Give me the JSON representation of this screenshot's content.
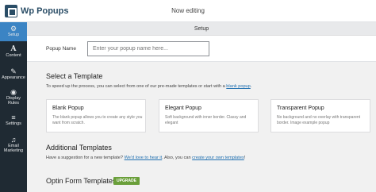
{
  "app": {
    "logo_text": "Wp Popups",
    "status": "Now editing"
  },
  "sidebar": {
    "items": [
      {
        "label": "Setup",
        "icon": "gear-icon"
      },
      {
        "label": "Content",
        "icon": "text-icon"
      },
      {
        "label": "Appearance",
        "icon": "paint-icon"
      },
      {
        "label": "Display Rules",
        "icon": "eye-icon"
      },
      {
        "label": "Settings",
        "icon": "sliders-icon"
      },
      {
        "label": "Email Marketing",
        "icon": "megaphone-icon"
      }
    ]
  },
  "header": {
    "section_title": "Setup"
  },
  "form": {
    "name_label": "Popup Name",
    "name_placeholder": "Enter your popup name here..."
  },
  "templates": {
    "title": "Select a Template",
    "intro": "To speed up the process, you can select from one of our pre-made templates or start with a",
    "intro_link": "blank popup",
    "intro_end": ".",
    "cards": [
      {
        "title": "Blank Popup",
        "desc": "The blank popup allows you to create any style you want from scratch."
      },
      {
        "title": "Elegant Popup",
        "desc": "Soft background with inner border. Classy and elegant"
      },
      {
        "title": "Transparent Popup",
        "desc": "No background and no overlay with transparent border. Image example popup"
      }
    ]
  },
  "additional": {
    "title": "Additional Templates",
    "text1": "Have a suggestion for a new template?",
    "link1": "We'd love to hear it",
    "text2": ". Also, you can",
    "link2": "create your own templates",
    "text3": "!"
  },
  "optin": {
    "title": "Optin Form Templates",
    "badge": "UPGRADE"
  }
}
